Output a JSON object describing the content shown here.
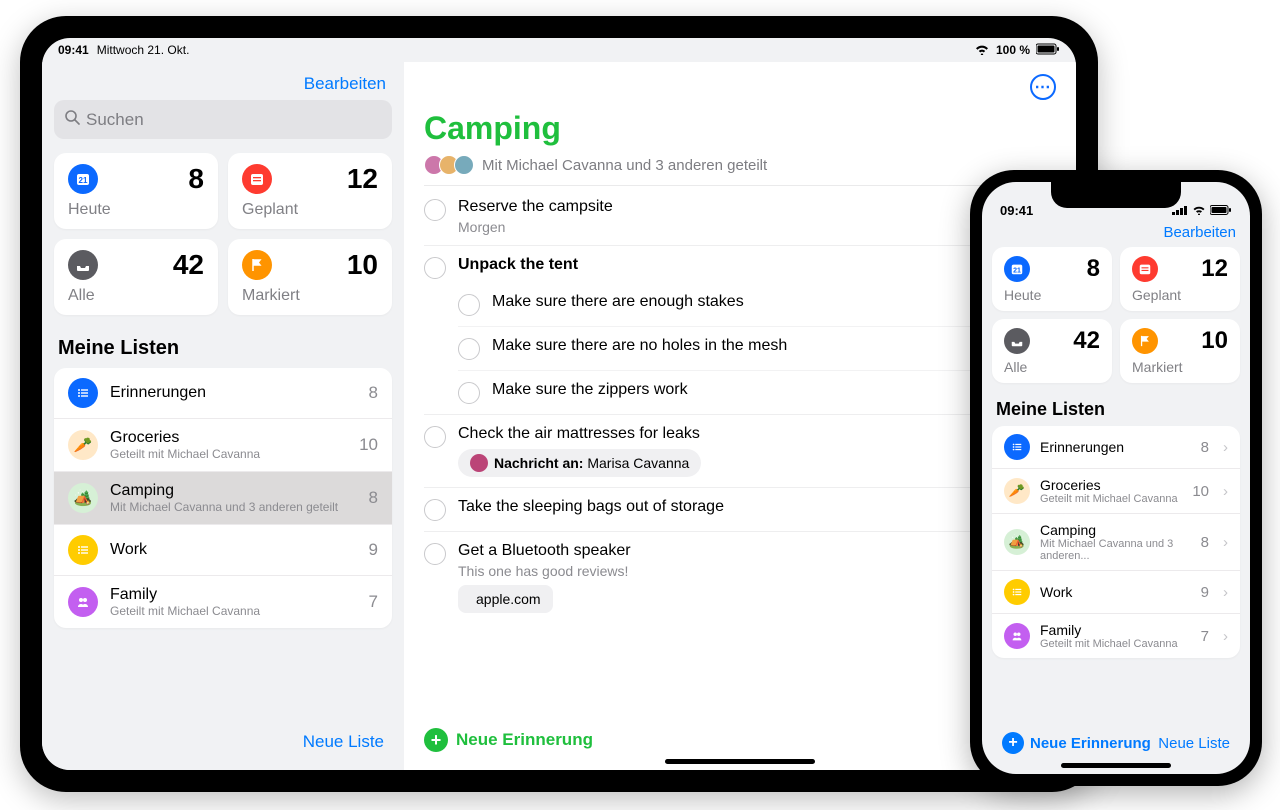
{
  "ipad": {
    "status": {
      "time": "09:41",
      "date": "Mittwoch 21. Okt.",
      "battery": "100 %"
    },
    "sidebar": {
      "edit": "Bearbeiten",
      "search_placeholder": "Suchen",
      "smart": [
        {
          "label": "Heute",
          "count": "8"
        },
        {
          "label": "Geplant",
          "count": "12"
        },
        {
          "label": "Alle",
          "count": "42"
        },
        {
          "label": "Markiert",
          "count": "10"
        }
      ],
      "section": "Meine Listen",
      "lists": [
        {
          "title": "Erinnerungen",
          "sub": "",
          "count": "8"
        },
        {
          "title": "Groceries",
          "sub": "Geteilt mit Michael Cavanna",
          "count": "10"
        },
        {
          "title": "Camping",
          "sub": "Mit Michael Cavanna und 3 anderen geteilt",
          "count": "8"
        },
        {
          "title": "Work",
          "sub": "",
          "count": "9"
        },
        {
          "title": "Family",
          "sub": "Geteilt mit Michael Cavanna",
          "count": "7"
        }
      ],
      "new_list": "Neue Liste"
    },
    "detail": {
      "title": "Camping",
      "shared": "Mit Michael Cavanna und 3 anderen geteilt",
      "tasks": {
        "t0": {
          "title": "Reserve the campsite",
          "meta": "Morgen"
        },
        "t1": {
          "title": "Unpack the tent"
        },
        "subs": [
          "Make sure there are enough stakes",
          "Make sure there are no holes in the mesh",
          "Make sure the zippers work"
        ],
        "t2": {
          "title": "Check the air mattresses for leaks",
          "chip_prefix": "Nachricht an:",
          "chip_name": " Marisa Cavanna"
        },
        "t3": {
          "title": "Take the sleeping bags out of storage"
        },
        "t4": {
          "title": "Get a Bluetooth speaker",
          "meta": "This one has good reviews!",
          "link": "apple.com"
        }
      },
      "new_reminder": "Neue Erinnerung"
    }
  },
  "iphone": {
    "status": {
      "time": "09:41"
    },
    "edit": "Bearbeiten",
    "smart": [
      {
        "label": "Heute",
        "count": "8"
      },
      {
        "label": "Geplant",
        "count": "12"
      },
      {
        "label": "Alle",
        "count": "42"
      },
      {
        "label": "Markiert",
        "count": "10"
      }
    ],
    "section": "Meine Listen",
    "lists": [
      {
        "title": "Erinnerungen",
        "sub": "",
        "count": "8"
      },
      {
        "title": "Groceries",
        "sub": "Geteilt mit Michael Cavanna",
        "count": "10"
      },
      {
        "title": "Camping",
        "sub": "Mit Michael Cavanna und 3 anderen...",
        "count": "8"
      },
      {
        "title": "Work",
        "sub": "",
        "count": "9"
      },
      {
        "title": "Family",
        "sub": "Geteilt mit Michael Cavanna",
        "count": "7"
      }
    ],
    "new_reminder": "Neue Erinnerung",
    "new_list": "Neue Liste"
  }
}
